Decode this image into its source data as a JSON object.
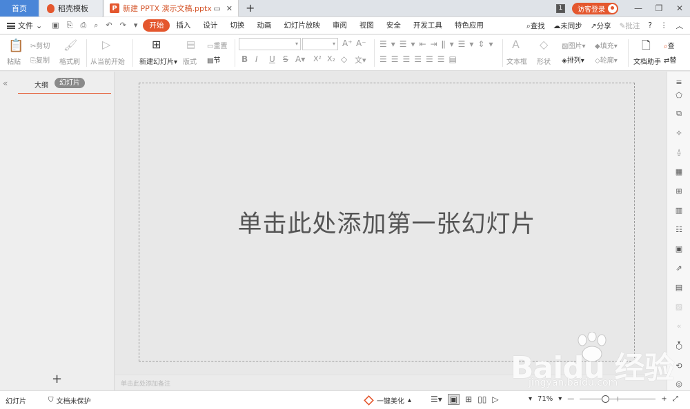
{
  "tabs": {
    "home": "首页",
    "daoke": "稻壳模板",
    "document": "新建 PPTX 演示文稿.pptx",
    "doc_icon": "P",
    "add": "+"
  },
  "titlebar": {
    "window_count": "1",
    "login": "访客登录"
  },
  "menu": {
    "file": "文件",
    "items": [
      "开始",
      "插入",
      "设计",
      "切换",
      "动画",
      "幻灯片放映",
      "审阅",
      "视图",
      "安全",
      "开发工具",
      "特色应用"
    ],
    "search": "查找",
    "sync": "未同步",
    "share": "分享",
    "comment": "批注",
    "help": "?"
  },
  "ribbon": {
    "paste": "粘贴",
    "cut": "剪切",
    "copy": "复制",
    "format_painter": "格式刷",
    "play_from_current": "从当前开始",
    "new_slide": "新建幻灯片",
    "layout": "版式",
    "reset": "重置",
    "section": "节",
    "textbox": "文本框",
    "shape": "形状",
    "picture": "图片",
    "fill": "填充",
    "arrange": "排列",
    "outline": "轮廓",
    "doc_assistant": "文档助手",
    "find": "查",
    "replace": "替"
  },
  "left_panel": {
    "outline_tab": "大纲",
    "slides_tab": "幻灯片",
    "add": "+"
  },
  "slide": {
    "placeholder": "单击此处添加第一张幻灯片"
  },
  "notes": {
    "placeholder": "单击此处添加备注"
  },
  "status": {
    "mode": "幻灯片",
    "protection": "文档未保护",
    "beautify": "一键美化",
    "zoom": "71%"
  },
  "watermark": {
    "brand": "Baidu 经验",
    "url": "jingyan.baidu.com"
  },
  "colors": {
    "accent": "#e4572e",
    "home_tab": "#4a86d8",
    "canvas": "#e8e8e8"
  }
}
